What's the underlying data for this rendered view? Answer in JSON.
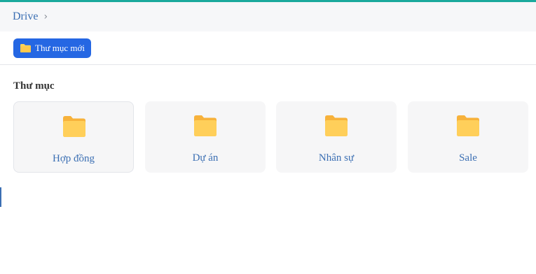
{
  "breadcrumb": {
    "root": "Drive",
    "separator": "›"
  },
  "toolbar": {
    "new_folder_label": "Thư mục mới",
    "new_folder_icon": "folder-icon"
  },
  "section": {
    "title": "Thư mục"
  },
  "folders": [
    {
      "name": "Hợp đồng",
      "icon": "folder-icon"
    },
    {
      "name": "Dự án",
      "icon": "folder-icon"
    },
    {
      "name": "Nhân sự",
      "icon": "folder-icon"
    },
    {
      "name": "Sale",
      "icon": "folder-icon"
    }
  ],
  "colors": {
    "accent": "#1aa99d",
    "primary_button": "#2567e3",
    "link_text": "#3b6fb3",
    "folder_yellow": "#ffc94d"
  }
}
